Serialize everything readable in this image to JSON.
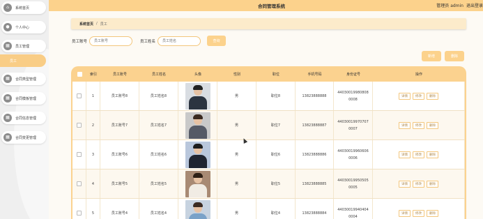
{
  "app": {
    "title": "合同管理系统",
    "user": "管理员 admin",
    "logout": "退出登录"
  },
  "sidebar": {
    "items": [
      {
        "label": "系统首页",
        "icon": "home-icon",
        "glyph": "⌂"
      },
      {
        "label": "个人中心",
        "icon": "user-icon",
        "glyph": "●"
      },
      {
        "label": "员工管理",
        "icon": "grid-icon",
        "glyph": "▦"
      },
      {
        "label": "合同类型管理",
        "icon": "grid-icon",
        "glyph": "▦"
      },
      {
        "label": "合同模板管理",
        "icon": "grid-icon",
        "glyph": "▦"
      },
      {
        "label": "合同信息管理",
        "icon": "grid-icon",
        "glyph": "▦"
      },
      {
        "label": "合同变更管理",
        "icon": "grid-icon",
        "glyph": "▦"
      }
    ],
    "sub_item": "员工"
  },
  "breadcrumb": {
    "home": "系统首页",
    "sep": "/",
    "current": "员工"
  },
  "search": {
    "account_label": "员工账号",
    "account_placeholder": "员工账号",
    "name_label": "员工姓名",
    "name_placeholder": "员工姓名",
    "button": "查询"
  },
  "toolbar": {
    "add": "新增",
    "delete": "删除"
  },
  "table": {
    "headers": [
      "",
      "索引",
      "员工账号",
      "员工姓名",
      "头像",
      "性别",
      "职位",
      "手机号码",
      "身份证号",
      "操作"
    ],
    "actions": [
      "详情",
      "修改",
      "删除"
    ],
    "rows": [
      {
        "index": "1",
        "account": "员工账号8",
        "name": "员工姓名8",
        "gender": "男",
        "position": "职位8",
        "phone": "13823888888",
        "id_card": "440300199808080008",
        "avatar": "man-suit"
      },
      {
        "index": "2",
        "account": "员工账号7",
        "name": "员工姓名7",
        "gender": "男",
        "position": "职位7",
        "phone": "13823888887",
        "id_card": "440300199707070007",
        "avatar": "woman-vest"
      },
      {
        "index": "3",
        "account": "员工账号6",
        "name": "员工姓名6",
        "gender": "男",
        "position": "职位6",
        "phone": "13823888886",
        "id_card": "440300199606060006",
        "avatar": "man-dark-suit"
      },
      {
        "index": "4",
        "account": "员工账号5",
        "name": "员工姓名5",
        "gender": "男",
        "position": "职位5",
        "phone": "13823888885",
        "id_card": "440300199505050005",
        "avatar": "woman-white"
      },
      {
        "index": "5",
        "account": "员工账号4",
        "name": "员工姓名4",
        "gender": "男",
        "position": "职位4",
        "phone": "13823888884",
        "id_card": "440300199404040004",
        "avatar": "woman-blue"
      }
    ]
  },
  "colors": {
    "accent": "#fcd28c",
    "accent_light": "#fcebcb",
    "table_header": "#fbd28f"
  }
}
